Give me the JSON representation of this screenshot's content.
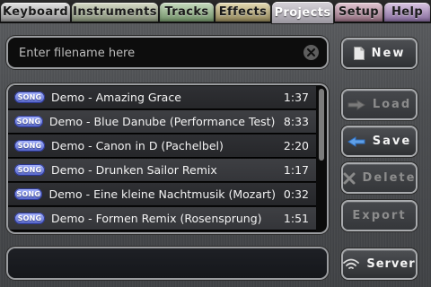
{
  "tabs": [
    {
      "label": "Keyboard"
    },
    {
      "label": "Instruments"
    },
    {
      "label": "Tracks"
    },
    {
      "label": "Effects"
    },
    {
      "label": "Projects",
      "active": true
    },
    {
      "label": "Setup"
    },
    {
      "label": "Help"
    }
  ],
  "filename": {
    "value": "",
    "placeholder": "Enter filename here"
  },
  "song_badge": "SONG",
  "songs": [
    {
      "title": "Demo - Amazing Grace",
      "duration": "1:37"
    },
    {
      "title": "Demo - Blue Danube (Performance Test)",
      "duration": "8:33"
    },
    {
      "title": "Demo - Canon in D (Pachelbel)",
      "duration": "2:20"
    },
    {
      "title": "Demo - Drunken Sailor Remix",
      "duration": "1:17"
    },
    {
      "title": "Demo - Eine kleine Nachtmusik (Mozart)",
      "duration": "0:32"
    },
    {
      "title": "Demo - Formen Remix (Rosensprung)",
      "duration": "1:51"
    }
  ],
  "buttons": {
    "new": "New",
    "load": "Load",
    "save": "Save",
    "delete": "Delete",
    "export": "Export",
    "server": "Server"
  },
  "icons": {
    "new": "document-icon",
    "load": "arrow-right-icon",
    "save": "arrow-left-icon",
    "delete": "x-icon",
    "server": "wifi-icon",
    "clear": "clear-circle-icon"
  },
  "colors": {
    "badge": "#6f7fe6",
    "save_arrow": "#5fa0e8",
    "active_tab": "#c8c4cc"
  }
}
